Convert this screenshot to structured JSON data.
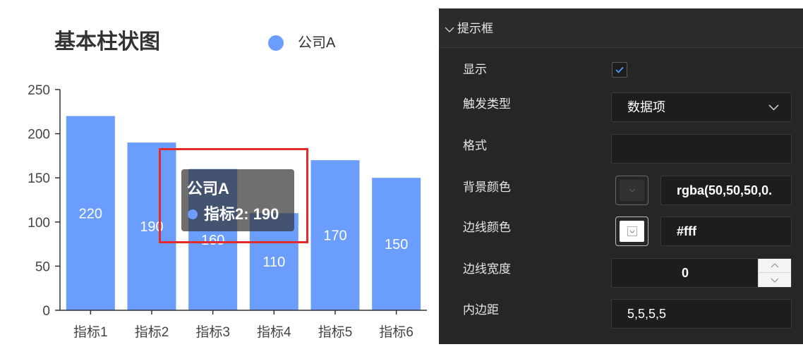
{
  "chart": {
    "colors": {
      "bar": "#6b9dff",
      "highlight": "#e32b2b"
    }
  },
  "chart_data": {
    "type": "bar",
    "title": "基本柱状图",
    "categories": [
      "指标1",
      "指标2",
      "指标3",
      "指标4",
      "指标5",
      "指标6"
    ],
    "series": [
      {
        "name": "公司A",
        "values": [
          220,
          190,
          160,
          110,
          170,
          150
        ]
      }
    ],
    "ylim": [
      0,
      250
    ],
    "yticks": [
      0,
      50,
      100,
      150,
      200,
      250
    ],
    "legend": "top",
    "grid": false,
    "data_labels": true
  },
  "tooltip": {
    "series_name": "公司A",
    "item": "指标2: 190"
  },
  "panel": {
    "header": {
      "icon": "chevron-down-icon",
      "title": "提示框"
    },
    "show": {
      "label": "显示",
      "checked": true
    },
    "trigger": {
      "label": "触发类型",
      "value": "数据项",
      "icon": "chevron-down-icon"
    },
    "format": {
      "label": "格式"
    },
    "background_color": {
      "label": "背景颜色",
      "swatch": "#323232",
      "value": "rgba(50,50,50,0."
    },
    "border_color": {
      "label": "边线颜色",
      "swatch": "#ffffff",
      "value": "#fff"
    },
    "border_width": {
      "label": "边线宽度",
      "value": "0",
      "icons": [
        "chevron-up-icon",
        "chevron-down-icon"
      ]
    },
    "padding": {
      "label": "内边距",
      "value": "5,5,5,5"
    }
  }
}
